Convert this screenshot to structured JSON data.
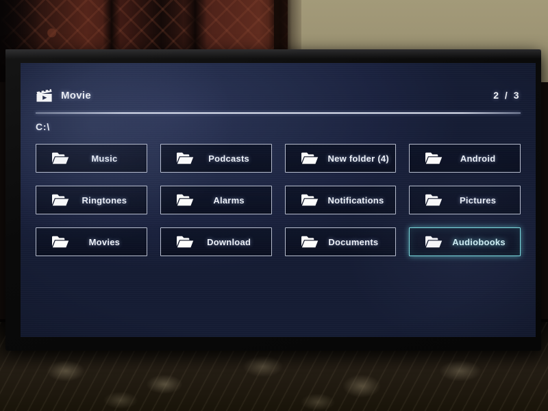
{
  "screen": {
    "header": {
      "icon": "clapperboard-icon",
      "title": "Movie",
      "page_indicator": "2 / 3"
    },
    "path": "C:\\",
    "folder_icon": "folder-icon",
    "tiles": [
      {
        "label": "Music",
        "selected": false
      },
      {
        "label": "Podcasts",
        "selected": false
      },
      {
        "label": "New folder (4)",
        "selected": false
      },
      {
        "label": "Android",
        "selected": false
      },
      {
        "label": "Ringtones",
        "selected": false
      },
      {
        "label": "Alarms",
        "selected": false
      },
      {
        "label": "Notifications",
        "selected": false
      },
      {
        "label": "Pictures",
        "selected": false
      },
      {
        "label": "Movies",
        "selected": false
      },
      {
        "label": "Download",
        "selected": false
      },
      {
        "label": "Documents",
        "selected": false
      },
      {
        "label": "Audiobooks",
        "selected": true
      }
    ],
    "colors": {
      "screen_background": "#1b2340",
      "tile_background": "#0c1428",
      "tile_border": "#e1e7f6",
      "text": "#eef2f9",
      "selection_accent": "#7fe3e6",
      "selection_text": "#d4f3f7"
    }
  },
  "scene": {
    "description": "photo-of-tv",
    "colors": {
      "bezel": "#0a0a0a",
      "wall": "#9c9373",
      "curtain": "#55251a",
      "carpet": "#241d14"
    }
  }
}
